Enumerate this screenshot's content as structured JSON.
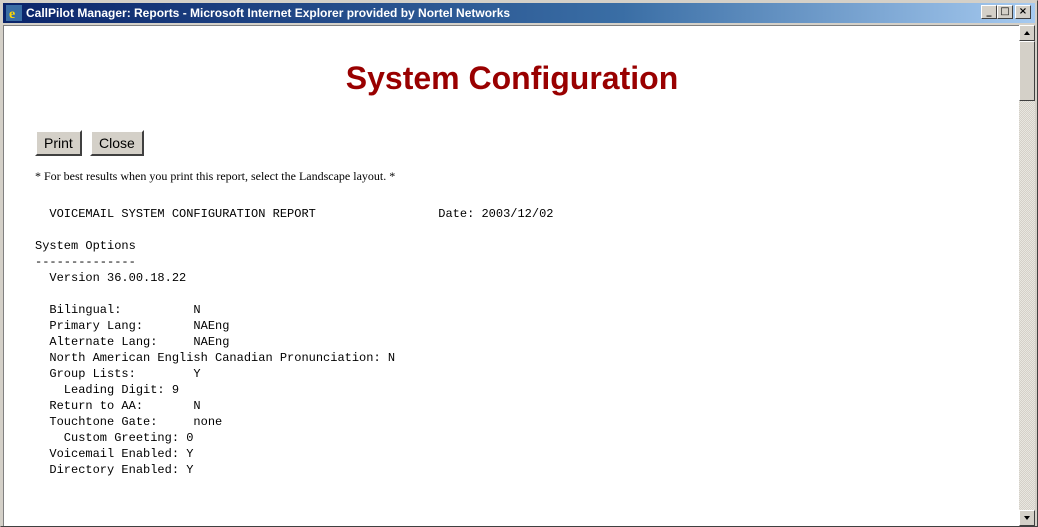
{
  "window": {
    "title": "CallPilot Manager: Reports - Microsoft Internet Explorer provided by Nortel Networks",
    "minimize_glyph": "_",
    "maximize_glyph": "□",
    "close_glyph": "×"
  },
  "page": {
    "heading": "System Configuration",
    "print_label": "Print",
    "close_label": "Close",
    "note": "* For best results when you print this report, select the Landscape layout. *"
  },
  "report": {
    "lines": [
      "  VOICEMAIL SYSTEM CONFIGURATION REPORT                 Date: 2003/12/02",
      "",
      "System Options",
      "--------------",
      "  Version 36.00.18.22",
      "",
      "  Bilingual:          N",
      "  Primary Lang:       NAEng",
      "  Alternate Lang:     NAEng",
      "  North American English Canadian Pronunciation: N",
      "  Group Lists:        Y",
      "    Leading Digit: 9",
      "  Return to AA:       N",
      "  Touchtone Gate:     none",
      "    Custom Greeting: 0",
      "  Voicemail Enabled: Y",
      "  Directory Enabled: Y"
    ]
  },
  "colors": {
    "heading": "#990000",
    "titlebar_start": "#0a246a",
    "titlebar_end": "#a6caf0"
  },
  "icons": {
    "title": "internet-explorer-icon"
  }
}
